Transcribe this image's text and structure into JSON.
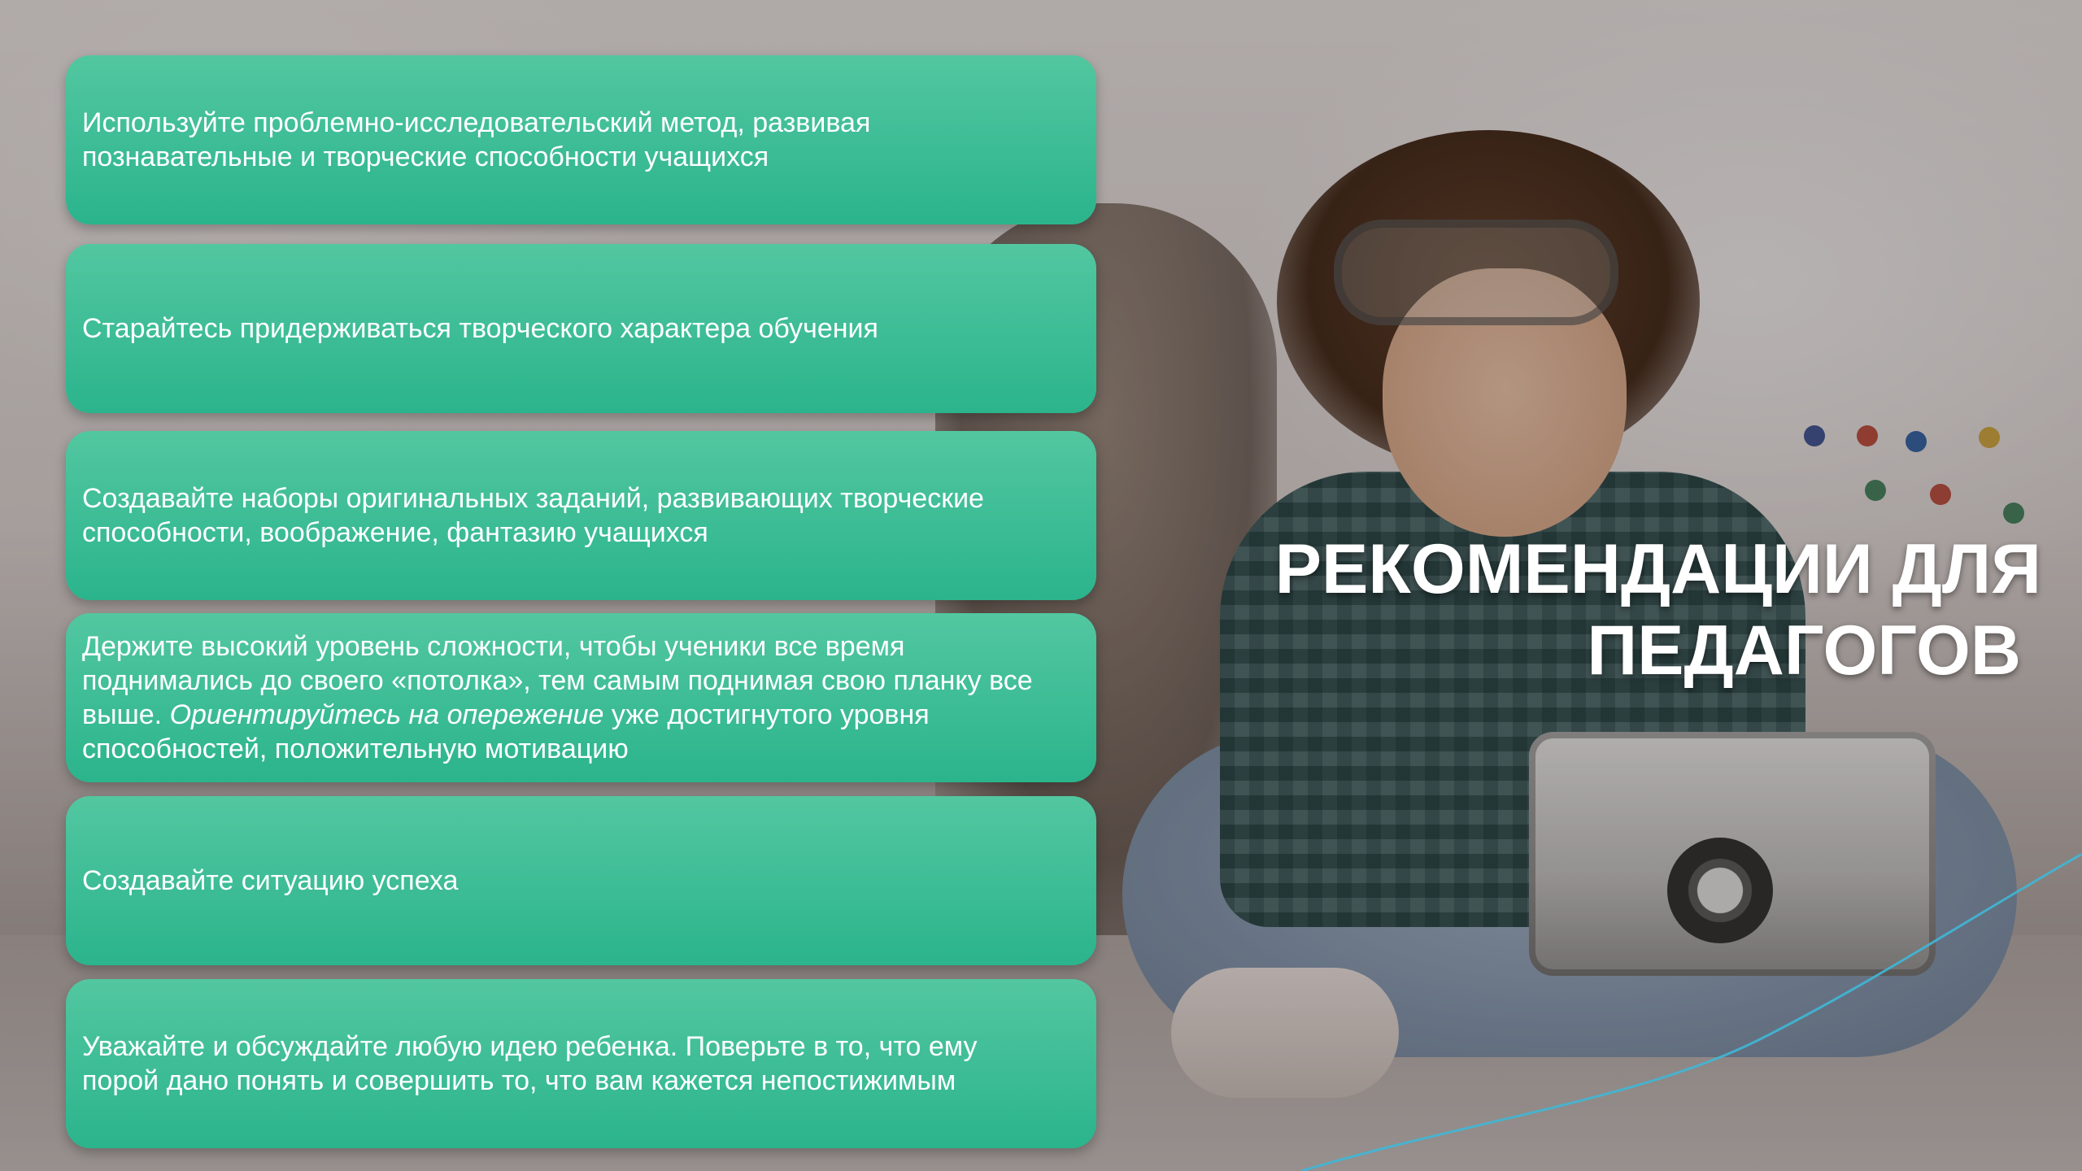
{
  "slide": {
    "title_line1": "РЕКОМЕНДАЦИИ ДЛЯ",
    "title_line2": "ПЕДАГОГОВ",
    "accent_color": "#2bb48c",
    "cards": [
      {
        "text": "Используйте проблемно-исследовательский метод, развивая познавательные и творческие способности учащихся"
      },
      {
        "text": "Старайтесь придерживаться творческого характера обучения"
      },
      {
        "text": "Создавайте наборы оригинальных заданий, развивающих творческие способности, воображение, фантазию учащихся"
      },
      {
        "text_before": "Держите высокий уровень сложности, чтобы ученики все время поднимались до своего «потолка», тем самым поднимая свою планку все выше. ",
        "text_italic": "Ориентируйтесь на опережение",
        "text_after": " уже достигнутого уровня способностей, положительную мотивацию"
      },
      {
        "text": "Создавайте ситуацию успеха"
      },
      {
        "text": "Уважайте и обсуждайте любую идею ребенка. Поверьте в то, что ему порой дано понять и совершить то, что вам кажется непостижимым"
      }
    ]
  }
}
